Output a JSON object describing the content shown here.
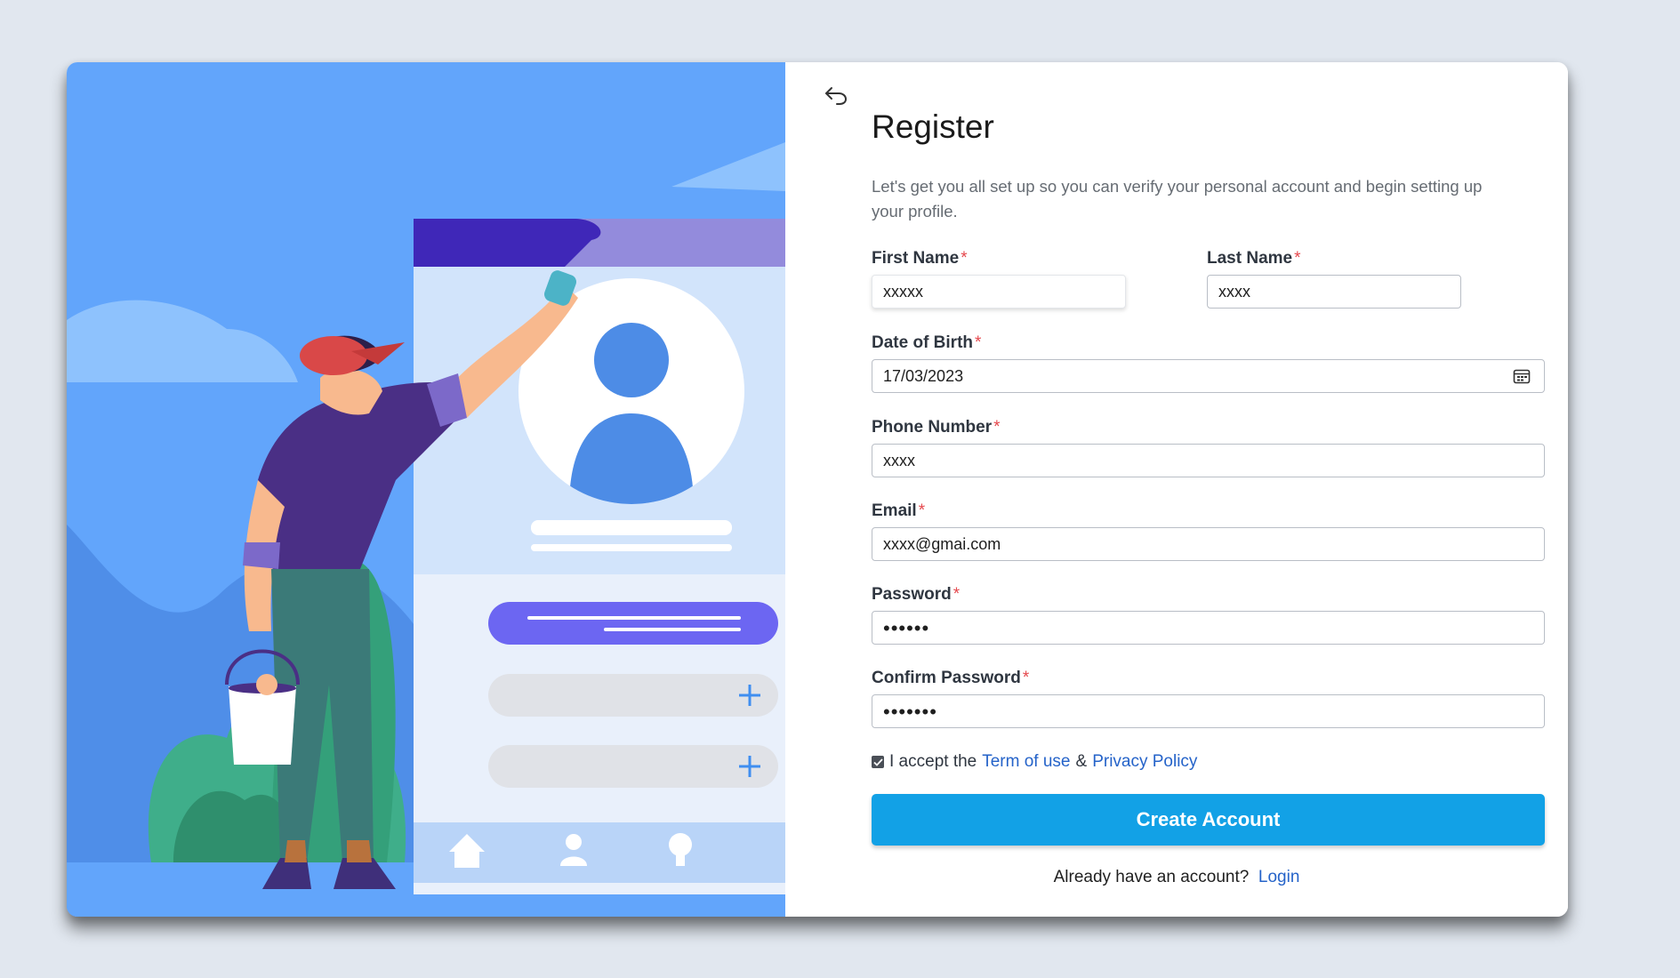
{
  "form": {
    "title": "Register",
    "subtitle": "Let's get you all set up so you can verify your personal account and begin setting up your profile.",
    "required_mark": "*",
    "first_name": {
      "label": "First Name",
      "value": "xxxxx"
    },
    "last_name": {
      "label": "Last Name",
      "value": "xxxx"
    },
    "dob": {
      "label": "Date of Birth",
      "value": "17/03/2023"
    },
    "phone": {
      "label": "Phone Number",
      "value": "xxxx"
    },
    "email": {
      "label": "Email",
      "value": "xxxx@gmai.com"
    },
    "password": {
      "label": "Password",
      "value": "••••••"
    },
    "confirm_password": {
      "label": "Confirm Password",
      "value": "•••••••"
    },
    "terms": {
      "checked": true,
      "prefix": "I accept the",
      "term_link": "Term of use",
      "ampersand": "&",
      "privacy_link": "Privacy Policy"
    },
    "submit_label": "Create Account",
    "login_prompt": "Already have an account?",
    "login_link": "Login"
  },
  "icons": {
    "back": "undo-arrow-icon",
    "calendar": "calendar-icon",
    "checkbox": "checkbox-checked-icon"
  },
  "colors": {
    "illustration_bg": "#62a5fb",
    "primary_button": "#12a1e6",
    "link": "#2563c9",
    "required": "#e5484d"
  }
}
